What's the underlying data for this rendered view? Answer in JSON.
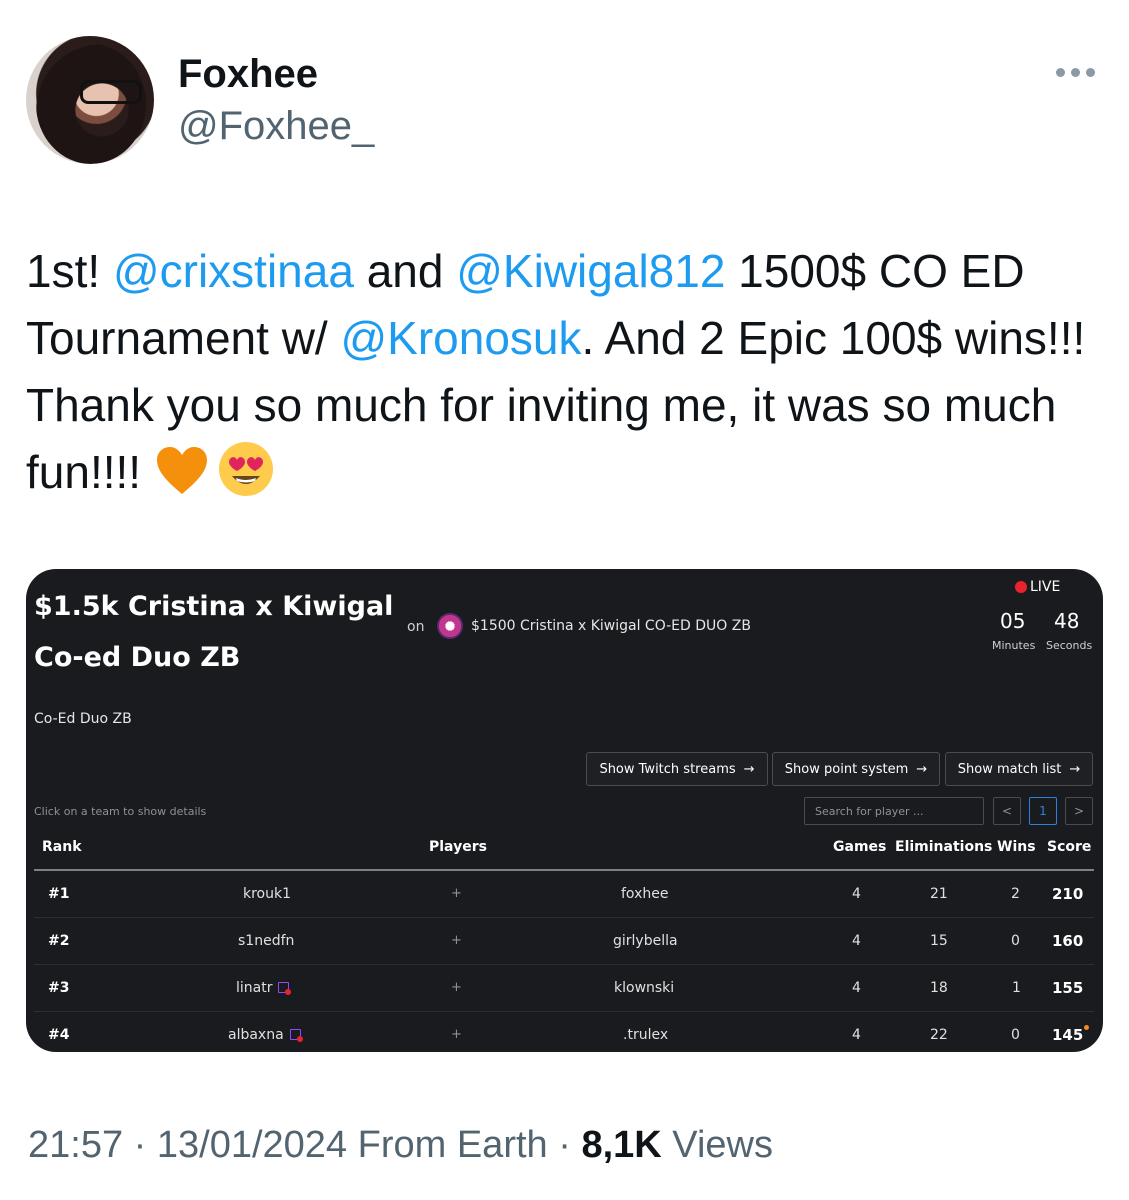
{
  "author": {
    "display_name": "Foxhee",
    "handle": "@Foxhee_"
  },
  "tweet": {
    "parts": [
      "1st! ",
      "@crixstinaa",
      "  and ",
      "@Kiwigal812",
      "  1500$ CO ED Tournament w/ ",
      "@Kronosuk",
      ".  And 2 Epic 100$ wins!!! Thank you so much for inviting me, it was so much fun!!!!"
    ],
    "emojis": [
      "orange-heart",
      "heart-eyes-face"
    ]
  },
  "card": {
    "title_line1": "$1.5k Cristina x Kiwigal",
    "title_line2": "Co-ed Duo ZB",
    "on_label": "on",
    "event_name": "$1500 Cristina x Kiwigal CO-ED DUO ZB",
    "live_label": "LIVE",
    "timer": {
      "minutes": "05",
      "seconds": "48",
      "minutes_label": "Minutes",
      "seconds_label": "Seconds"
    },
    "subtitle": "Co-Ed Duo ZB",
    "buttons": {
      "twitch": "Show Twitch streams",
      "points": "Show point system",
      "matches": "Show match list"
    },
    "hint": "Click on a team to show details",
    "search_placeholder": "Search for player ...",
    "pagination": {
      "prev": "<",
      "current": "1",
      "next": ">"
    },
    "headers": {
      "rank": "Rank",
      "players": "Players",
      "games": "Games",
      "eliminations": "Eliminations",
      "wins": "Wins",
      "score": "Score"
    },
    "rows": [
      {
        "rank": "#1",
        "p1": "krouk1",
        "p2": "foxhee",
        "games": "4",
        "elims": "21",
        "wins": "2",
        "score": "210"
      },
      {
        "rank": "#2",
        "p1": "s1nedfn",
        "p2": "girlybella",
        "games": "4",
        "elims": "15",
        "wins": "0",
        "score": "160"
      },
      {
        "rank": "#3",
        "p1": "linatr",
        "p2": "klownski",
        "games": "4",
        "elims": "18",
        "wins": "1",
        "score": "155"
      },
      {
        "rank": "#4",
        "p1": "albaxna",
        "p2": ".trulex",
        "games": "4",
        "elims": "22",
        "wins": "0",
        "score": "145"
      }
    ],
    "plus_sign": "+",
    "colors": {
      "background": "#1a1b1f",
      "live": "#e8232d",
      "pagination_active": "#2f7fe0",
      "twitch": "#9146ff"
    }
  },
  "footer": {
    "time": "21:57",
    "sep": " · ",
    "date": "13/01/2024",
    "source": "From Earth",
    "views_count": "8,1K",
    "views_label": "Views"
  },
  "colors": {
    "mention": "#1d9bf0",
    "secondary_text": "#536471",
    "primary_text": "#0f1419"
  }
}
